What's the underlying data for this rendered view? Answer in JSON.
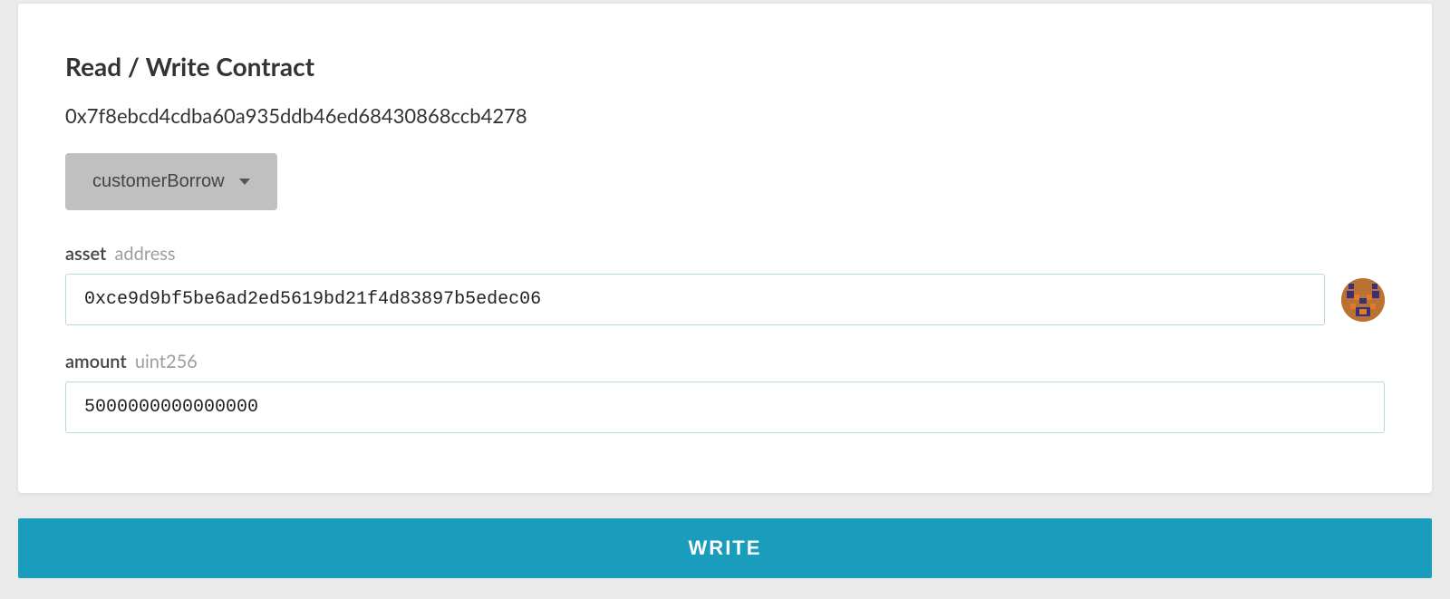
{
  "panel": {
    "title": "Read / Write Contract",
    "contractAddress": "0x7f8ebcd4cdba60a935ddb46ed68430868ccb4278",
    "functionSelect": {
      "selected": "customerBorrow"
    },
    "fields": [
      {
        "name": "asset",
        "type": "address",
        "value": "0xce9d9bf5be6ad2ed5619bd21f4d83897b5edec06",
        "hasAvatar": true
      },
      {
        "name": "amount",
        "type": "uint256",
        "value": "5000000000000000",
        "hasAvatar": false
      }
    ]
  },
  "actions": {
    "writeButton": "WRITE"
  }
}
